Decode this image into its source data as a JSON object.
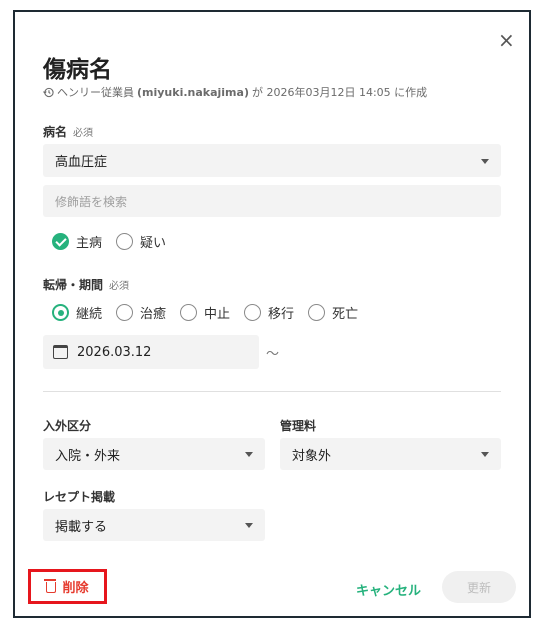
{
  "dialog": {
    "title": "傷病名",
    "close_icon": "×",
    "meta_prefix": "ヘンリー従業員",
    "meta_user": "(miyuki.nakajima)",
    "meta_suffix": "が 2026年03月12日 14:05 に作成"
  },
  "disease": {
    "label": "病名",
    "required": "必須",
    "value": "高血圧症",
    "modifier_placeholder": "修飾語を検索",
    "options": [
      {
        "label": "主病",
        "checked": true
      },
      {
        "label": "疑い",
        "checked": false
      }
    ]
  },
  "outcome": {
    "label": "転帰・期間",
    "required": "必須",
    "options": [
      {
        "label": "継続",
        "selected": true
      },
      {
        "label": "治癒",
        "selected": false
      },
      {
        "label": "中止",
        "selected": false
      },
      {
        "label": "移行",
        "selected": false
      },
      {
        "label": "死亡",
        "selected": false
      }
    ],
    "start_date": "2026.03.12",
    "range_separator": "〜"
  },
  "admission": {
    "label": "入外区分",
    "value": "入院・外来"
  },
  "management_fee": {
    "label": "管理料",
    "value": "対象外"
  },
  "receipt": {
    "label": "レセプト掲載",
    "value": "掲載する"
  },
  "footer": {
    "delete_label": "削除",
    "cancel_label": "キャンセル",
    "update_label": "更新"
  },
  "colors": {
    "accent": "#26b27d",
    "danger": "#e63b2e",
    "highlight_border": "#e6161d"
  }
}
